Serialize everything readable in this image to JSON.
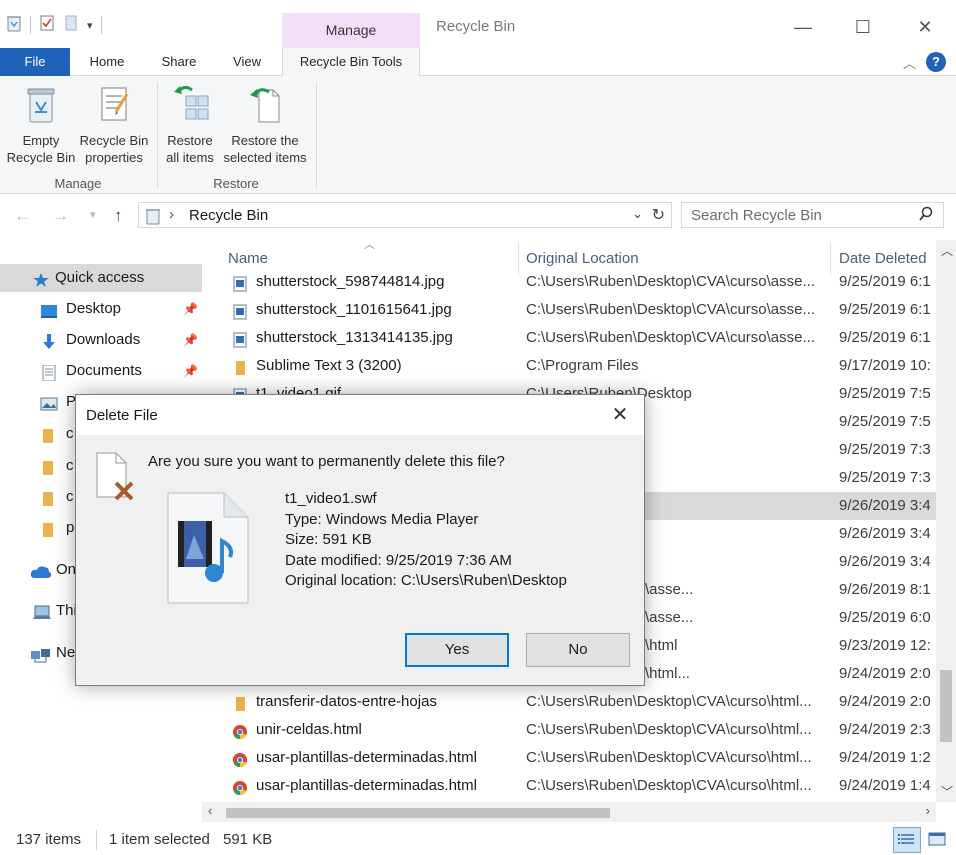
{
  "window": {
    "title": "Recycle Bin",
    "context_tab": "Manage"
  },
  "ribbon": {
    "tabs": [
      "File",
      "Home",
      "Share",
      "View",
      "Recycle Bin Tools"
    ],
    "groups": {
      "manage": {
        "label": "Manage",
        "buttons": [
          "Empty\nRecycle Bin",
          "Recycle Bin\nproperties"
        ]
      },
      "restore": {
        "label": "Restore",
        "buttons": [
          "Restore\nall items",
          "Restore the\nselected items"
        ]
      }
    },
    "empty_line1": "Empty",
    "empty_line2": "Recycle Bin",
    "props_line1": "Recycle Bin",
    "props_line2": "properties",
    "restore_all_line1": "Restore",
    "restore_all_line2": "all items",
    "restore_sel_line1": "Restore the",
    "restore_sel_line2": "selected items"
  },
  "address": {
    "path": "Recycle Bin",
    "search_placeholder": "Search Recycle Bin"
  },
  "nav": {
    "items": [
      {
        "label": "Quick access",
        "icon": "star-icon"
      },
      {
        "label": "Desktop",
        "icon": "desktop-icon"
      },
      {
        "label": "Downloads",
        "icon": "download-icon"
      },
      {
        "label": "Documents",
        "icon": "documents-icon"
      },
      {
        "label": "P",
        "icon": "pictures-icon"
      },
      {
        "label": "c",
        "icon": "folder-icon"
      },
      {
        "label": "c",
        "icon": "folder-icon"
      },
      {
        "label": "c",
        "icon": "folder-icon"
      },
      {
        "label": "p",
        "icon": "folder-icon"
      },
      {
        "label": "On",
        "icon": "cloud-icon"
      },
      {
        "label": "Thi",
        "icon": "computer-icon"
      },
      {
        "label": "Ne",
        "icon": "network-icon"
      }
    ]
  },
  "list": {
    "columns": [
      "Name",
      "Original Location",
      "Date Deleted"
    ],
    "rows": [
      {
        "name": "shutterstock_598744814.jpg",
        "location": "C:\\Users\\Ruben\\Desktop\\CVA\\curso\\asse...",
        "date": "9/25/2019 6:1",
        "icon": "image-file-icon"
      },
      {
        "name": "shutterstock_1101615641.jpg",
        "location": "C:\\Users\\Ruben\\Desktop\\CVA\\curso\\asse...",
        "date": "9/25/2019 6:1",
        "icon": "image-file-icon"
      },
      {
        "name": "shutterstock_1313414135.jpg",
        "location": "C:\\Users\\Ruben\\Desktop\\CVA\\curso\\asse...",
        "date": "9/25/2019 6:1",
        "icon": "image-file-icon"
      },
      {
        "name": "Sublime Text 3 (3200)",
        "location": "C:\\Program Files",
        "date": "9/17/2019 10:",
        "icon": "folder-icon"
      },
      {
        "name": "t1_video1.gif",
        "location": "C:\\Users\\Ruben\\Desktop",
        "date": "9/25/2019 7:5",
        "icon": "image-file-icon"
      },
      {
        "name": "",
        "location": "esktop",
        "date": "9/25/2019 7:5",
        "icon": ""
      },
      {
        "name": "",
        "location": "esktop",
        "date": "9/25/2019 7:3",
        "icon": ""
      },
      {
        "name": "",
        "location": "esktop",
        "date": "9/25/2019 7:3",
        "icon": ""
      },
      {
        "name": "",
        "location": "esktop",
        "date": "9/26/2019 3:4",
        "icon": ""
      },
      {
        "name": "",
        "location": "esktop",
        "date": "9/26/2019 3:4",
        "icon": ""
      },
      {
        "name": "",
        "location": "esktop",
        "date": "9/26/2019 3:4",
        "icon": ""
      },
      {
        "name": "",
        "location": "esktop\\CVA\\curso\\asse...",
        "date": "9/26/2019 8:1",
        "icon": ""
      },
      {
        "name": "",
        "location": "esktop\\CVA\\curso\\asse...",
        "date": "9/25/2019 6:0",
        "icon": ""
      },
      {
        "name": "",
        "location": "esktop\\CVA\\curso\\html",
        "date": "9/23/2019 12:",
        "icon": ""
      },
      {
        "name": "",
        "location": "esktop\\CVA\\curso\\html...",
        "date": "9/24/2019 2:0",
        "icon": ""
      },
      {
        "name": "transferir-datos-entre-hojas",
        "location": "C:\\Users\\Ruben\\Desktop\\CVA\\curso\\html...",
        "date": "9/24/2019 2:0",
        "icon": "folder-icon"
      },
      {
        "name": "unir-celdas.html",
        "location": "C:\\Users\\Ruben\\Desktop\\CVA\\curso\\html...",
        "date": "9/24/2019 2:3",
        "icon": "chrome-icon"
      },
      {
        "name": "usar-plantillas-determinadas.html",
        "location": "C:\\Users\\Ruben\\Desktop\\CVA\\curso\\html...",
        "date": "9/24/2019 1:2",
        "icon": "chrome-icon"
      },
      {
        "name": "usar-plantillas-determinadas.html",
        "location": "C:\\Users\\Ruben\\Desktop\\CVA\\curso\\html...",
        "date": "9/24/2019 1:4",
        "icon": "chrome-icon"
      }
    ],
    "selected_row": 8
  },
  "status": {
    "count": "137 items",
    "selection": "1 item selected",
    "size": "591 KB"
  },
  "dialog": {
    "title": "Delete File",
    "question": "Are you sure you want to permanently delete this file?",
    "file_name": "t1_video1.swf",
    "type": "Type: Windows Media Player",
    "size": "Size: 591 KB",
    "modified": "Date modified: 9/25/2019 7:36 AM",
    "location": "Original location: C:\\Users\\Ruben\\Desktop",
    "yes": "Yes",
    "no": "No"
  },
  "colors": {
    "file_tab": "#1e63b8",
    "context_tab": "#f3dff7",
    "selection": "#d9d9d9",
    "dialog_default_border": "#0078d7"
  }
}
